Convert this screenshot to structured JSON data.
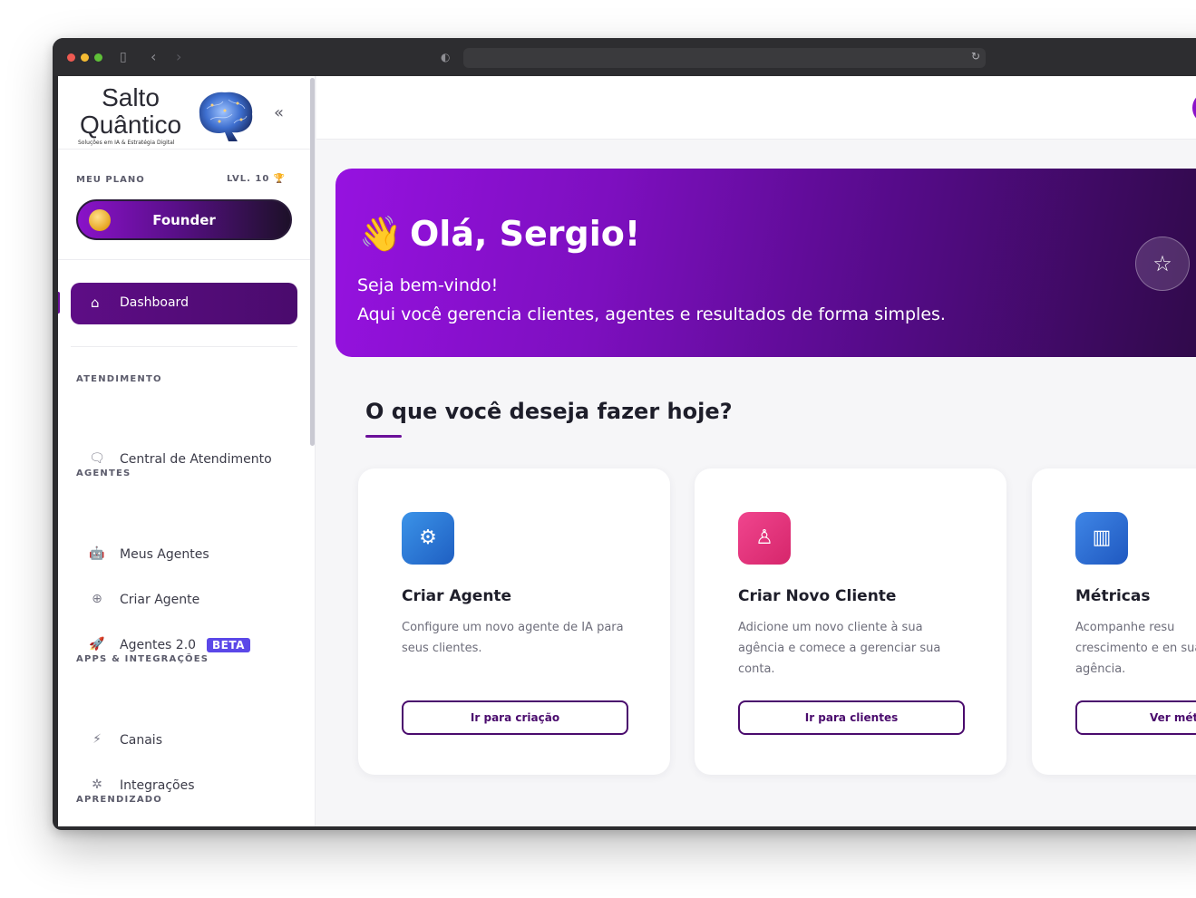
{
  "browser": {
    "icons": [
      "sidebar-icon",
      "back-icon",
      "forward-icon",
      "shield-icon",
      "reload-icon"
    ]
  },
  "logo": {
    "line1": "Salto",
    "line2": "Quântico",
    "tagline": "Soluções em IA & Estratégia Digital"
  },
  "plan": {
    "label": "MEU PLANO",
    "level": "LVL. 10",
    "name": "Founder"
  },
  "nav": {
    "dashboard": "Dashboard",
    "sections": {
      "atendimento": "ATENDIMENTO",
      "agentes": "AGENTES",
      "apps": "APPS & INTEGRAÇÕES",
      "aprendizado": "APRENDIZADO"
    },
    "items": {
      "central": "Central de Atendimento",
      "meus_agentes": "Meus Agentes",
      "criar_agente": "Criar Agente",
      "agentes20": "Agentes 2.0",
      "beta": "BETA",
      "canais": "Canais",
      "integracoes": "Integrações"
    }
  },
  "hero": {
    "wave": "👋",
    "title": "Olá, Sergio!",
    "subtitle1": "Seja bem-vindo!",
    "subtitle2": "Aqui você gerencia clientes, agentes e resultados de forma simples."
  },
  "question": "O que você deseja fazer hoje?",
  "cards": [
    {
      "title": "Criar Agente",
      "desc": "Configure um novo agente de IA para seus clientes.",
      "button": "Ir para criação",
      "color": "#2f7fd8",
      "icon": "robot-icon"
    },
    {
      "title": "Criar Novo Cliente",
      "desc": "Adicione um novo cliente à sua agência e comece a gerenciar sua conta.",
      "button": "Ir para clientes",
      "color": "#e8367f",
      "icon": "user-icon"
    },
    {
      "title": "Métricas",
      "desc": "Acompanhe resu crescimento e en sua agência.",
      "button": "Ver mét",
      "color": "#2e73d6",
      "icon": "bar-chart-icon"
    }
  ],
  "colors": {
    "primary": "#6b0f9a",
    "hero_start": "#9612e0",
    "hero_end": "#2b0a42"
  }
}
